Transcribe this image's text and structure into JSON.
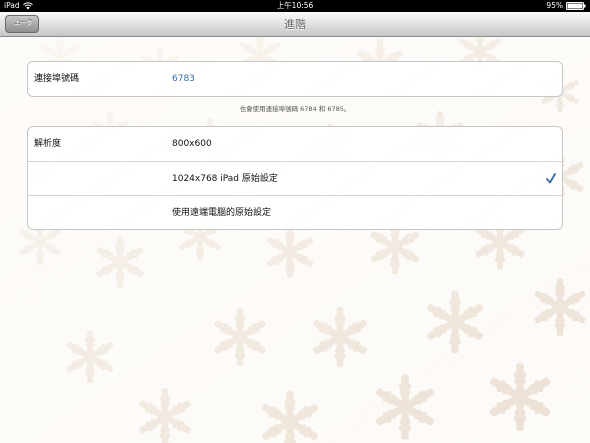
{
  "status_bar": {
    "carrier": "iPad",
    "time": "上午10:56",
    "battery": "95%"
  },
  "nav_bar": {
    "back_label": "上一步",
    "title": "進階"
  },
  "port_section": {
    "label": "連接埠號碼",
    "value": "6783",
    "footer": "也會使用連接埠號碼 6784 和 6785。"
  },
  "resolution_section": {
    "label": "解析度",
    "options": [
      {
        "label": "800x600",
        "selected": false
      },
      {
        "label": "1024x768 iPad 原始設定",
        "selected": true
      },
      {
        "label": "使用遠端電腦的原始設定",
        "selected": false
      }
    ]
  },
  "colors": {
    "link": "#3b6ea5",
    "snowflake": "#e6d7c8"
  },
  "icons": [
    "wifi-icon",
    "battery-icon",
    "checkmark-icon",
    "snowflake-pattern"
  ]
}
